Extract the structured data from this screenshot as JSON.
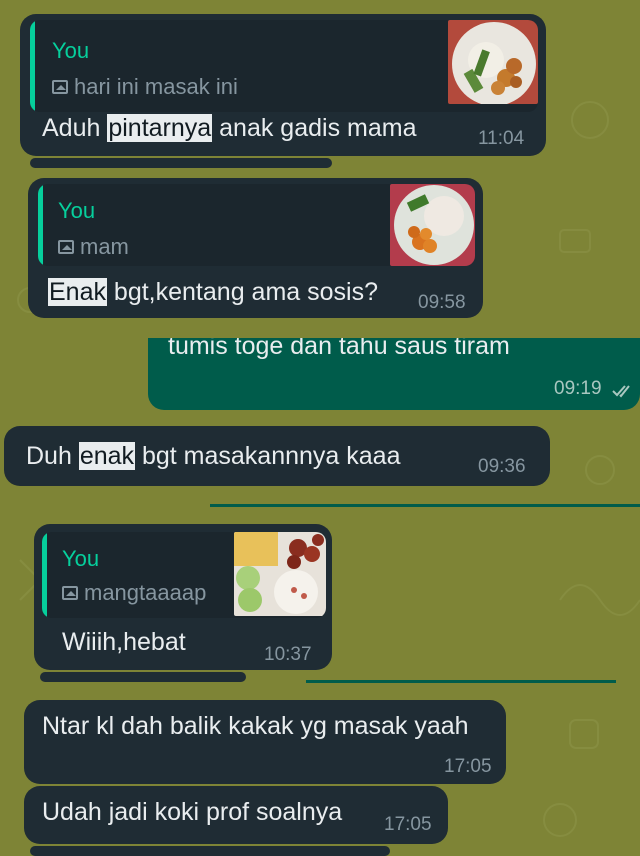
{
  "messages": [
    {
      "reply_author": "You",
      "reply_preview": "hari ini masak ini",
      "text_pre": "Aduh ",
      "text_hl": "pintarnya",
      "text_post": " anak gadis mama",
      "time": "11:04"
    },
    {
      "reply_author": "You",
      "reply_preview": "mam",
      "text_pre": "",
      "text_hl": "Enak",
      "text_post": " bgt,kentang ama sosis?",
      "time": "09:58"
    },
    {
      "text": "tumis toge dan tahu saus tiram",
      "time": "09:19"
    },
    {
      "text_pre": "Duh ",
      "text_hl": "enak",
      "text_post": " bgt masakannnya kaaa",
      "time": "09:36"
    },
    {
      "reply_author": "You",
      "reply_preview": "mangtaaaap",
      "text": "Wiiih,hebat",
      "time": "10:37"
    },
    {
      "text": "Ntar kl dah balik kakak yg masak yaah",
      "time": "17:05"
    },
    {
      "text": "Udah jadi koki prof soalnya",
      "time": "17:05"
    }
  ],
  "colors": {
    "wallpaper": "#7e8436",
    "incoming": "#1f2c34",
    "outgoing": "#005c4b",
    "reply_accent": "#06cf9c"
  },
  "icons": {
    "photo": "photo-icon",
    "read_receipt": "double-check-icon"
  }
}
